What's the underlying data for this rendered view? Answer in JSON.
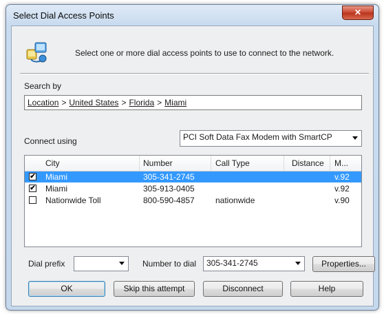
{
  "window": {
    "title": "Select Dial Access Points",
    "close_symbol": "✕"
  },
  "header": {
    "text": "Select one or more dial access points to use to connect to the network."
  },
  "search": {
    "label": "Search by",
    "breadcrumb": [
      "Location",
      "United States",
      "Florida",
      "Miami"
    ],
    "separator": ">"
  },
  "connect": {
    "label": "Connect using",
    "modem": "PCI Soft Data Fax Modem with SmartCP"
  },
  "list": {
    "columns": [
      "City",
      "Number",
      "Call Type",
      "Distance",
      "M..."
    ],
    "rows": [
      {
        "checked": true,
        "city": "Miami",
        "number": "305-341-2745",
        "call_type": "",
        "distance": "",
        "m": "v.92",
        "selected": true
      },
      {
        "checked": true,
        "city": "Miami",
        "number": "305-913-0405",
        "call_type": "",
        "distance": "",
        "m": "v.92",
        "selected": false
      },
      {
        "checked": false,
        "city": "Nationwide Toll",
        "number": "800-590-4857",
        "call_type": "nationwide",
        "distance": "",
        "m": "v.90",
        "selected": false
      }
    ]
  },
  "bottom": {
    "dial_prefix_label": "Dial prefix",
    "dial_prefix_value": "",
    "number_label": "Number to dial",
    "number_value": "305-341-2745",
    "properties_label": "Properties..."
  },
  "buttons": {
    "ok": "OK",
    "skip": "Skip this attempt",
    "disconnect": "Disconnect",
    "help": "Help"
  },
  "colors": {
    "selection": "#3399ff",
    "close_button": "#c8452d"
  },
  "checkmark": "✔"
}
